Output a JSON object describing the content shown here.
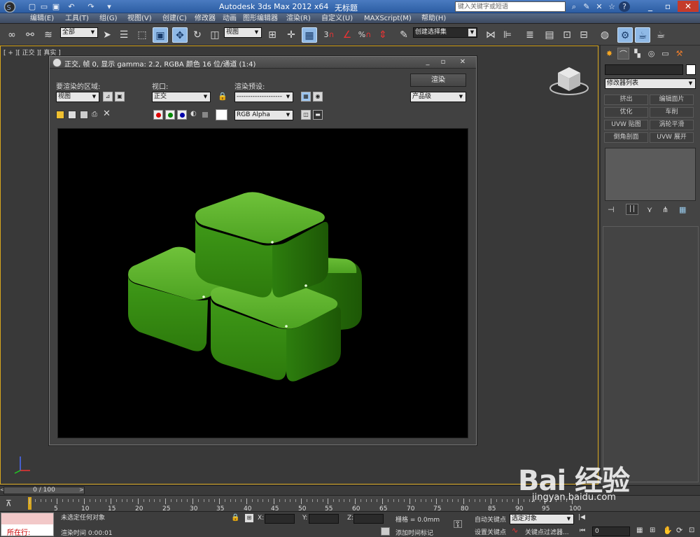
{
  "app": {
    "title": "Autodesk 3ds Max  2012 x64",
    "doc_title": "无标题",
    "search_placeholder": "键入关键字或短语"
  },
  "menu": [
    "编辑(E)",
    "工具(T)",
    "组(G)",
    "视图(V)",
    "创建(C)",
    "修改器",
    "动画",
    "图形编辑器",
    "渲染(R)",
    "自定义(U)",
    "MAXScript(M)",
    "帮助(H)"
  ],
  "toolbar": {
    "selection_filter": "全部",
    "coord_system": "视图",
    "named_selection": "创建选择集",
    "snap_3": "3",
    "snap_percent": "%"
  },
  "viewport": {
    "label": "[ + ][ 正交 ][ 真实 ]"
  },
  "render_window": {
    "title": "正交, 帧 0, 显示 gamma: 2.2, RGBA 颜色 16 位/通道 (1:4)",
    "area_label": "要渲染的区域:",
    "area_value": "视图",
    "viewport_label": "视口:",
    "viewport_value": "正交",
    "preset_label": "渲染预设:",
    "preset_value": "--------------------",
    "render_button": "渲染",
    "quality_value": "产品级",
    "channel_value": "RGB Alpha"
  },
  "command_panel": {
    "modifier_list": "修改器列表",
    "buttons": [
      "挤出",
      "编辑面片",
      "优化",
      "车削",
      "UVW 贴图",
      "涡轮平滑",
      "倒角剖面",
      "UVW 展开"
    ]
  },
  "timeline": {
    "slider": "0 / 100",
    "ticks": [
      "0",
      "5",
      "10",
      "15",
      "20",
      "25",
      "30",
      "35",
      "40",
      "45",
      "50",
      "55",
      "60",
      "65",
      "70",
      "75",
      "80",
      "85",
      "90",
      "95",
      "100"
    ]
  },
  "status": {
    "maxscript": "所在行:",
    "selection": "未选定任何对象",
    "render_time": "渲染时间  0:00:01",
    "x_label": "X:",
    "y_label": "Y:",
    "z_label": "Z:",
    "grid": "栅格 = 0.0mm",
    "add_time_tag": "添加时间标记",
    "auto_key": "自动关键点",
    "set_key": "设置关键点",
    "selected_objects": "选定对象",
    "key_filters": "关键点过滤器...",
    "frame": "0"
  },
  "watermark": {
    "brand": "Bai 经验",
    "url": "jingyan.baidu.com"
  }
}
